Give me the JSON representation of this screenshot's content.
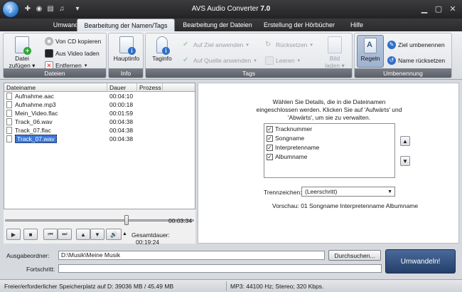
{
  "app": {
    "title_name": "AVS Audio Converter",
    "title_version": "7.0"
  },
  "tabs": [
    {
      "label": "Umwandlung"
    },
    {
      "label": "Bearbeitung der Namen/Tags",
      "active": true
    },
    {
      "label": "Bearbeitung der Dateien"
    },
    {
      "label": "Erstellung der Hörbücher"
    },
    {
      "label": "Hilfe"
    }
  ],
  "ribbon": {
    "dateien": {
      "label": "Dateien",
      "add_file_line1": "Datei",
      "add_file_line2": "zufügen",
      "cd_copy": "Von CD kopieren",
      "video_load": "Aus Video laden",
      "remove": "Entfernen"
    },
    "info": {
      "label": "Info",
      "hauptinfo": "Hauptinfo"
    },
    "tags": {
      "label": "Tags",
      "taginfo": "Taginfo",
      "apply_to_target": "Auf Ziel anwenden",
      "apply_to_source": "Auf Quelle anwenden",
      "reset": "Rücksetzen",
      "clear": "Leeren",
      "image_load_line1": "Bild",
      "image_load_line2": "laden"
    },
    "umbenennung": {
      "label": "Umbenennung",
      "rules": "Regeln",
      "rename_target": "Ziel umbenennen",
      "reset_name": "Name rücksetzen"
    }
  },
  "file_table": {
    "columns": [
      "Dateiname",
      "Dauer",
      "Prozess"
    ],
    "rows": [
      {
        "name": "Aufnahme.aac",
        "duration": "00:04:10"
      },
      {
        "name": "Aufnahme.mp3",
        "duration": "00:00:18"
      },
      {
        "name": "Mein_Video.flac",
        "duration": "00:01:59"
      },
      {
        "name": "Track_06.wav",
        "duration": "00:04:38"
      },
      {
        "name": "Track_07.flac",
        "duration": "00:04:38"
      },
      {
        "name": "Track_07.wav",
        "duration": "00:04:38",
        "selected": true
      }
    ]
  },
  "player": {
    "position_time": "00:03:34",
    "seek_fraction": 0.63,
    "total_label": "Gesamtdauer:",
    "total_time": "00:19:24"
  },
  "rename_panel": {
    "hint": "Wählen Sie Details, die in die Dateinamen eingeschlossen werden. Klicken Sie auf 'Aufwärts' und 'Abwärts', um sie zu verwalten.",
    "details": [
      {
        "label": "Tracknummer",
        "checked": true
      },
      {
        "label": "Songname",
        "checked": true
      },
      {
        "label": "Interpretenname",
        "checked": true
      },
      {
        "label": "Albumname",
        "checked": true
      }
    ],
    "separator_label": "Trennzeichen:",
    "separator_value": "(Leerschritt)",
    "preview_label": "Vorschau:",
    "preview_value": "01 Songname Interpretenname Albumname"
  },
  "bottom": {
    "output_label": "Ausgabeordner:",
    "output_value": "D:\\Musik\\Meine Musik",
    "browse": "Durchsuchen...",
    "progress_label": "Fortschritt:",
    "convert": "Umwandeln!"
  },
  "status": {
    "space": "Freier/erforderlicher Speicherplatz auf D: 39036 MB / 45.49 MB",
    "format": "MP3: 44100  Hz; Stereo; 320 Kbps."
  },
  "colors": {
    "accent": "#3a77d9",
    "convert_button": "#2c4a7a",
    "dark_chrome": "#2b2b2d"
  }
}
